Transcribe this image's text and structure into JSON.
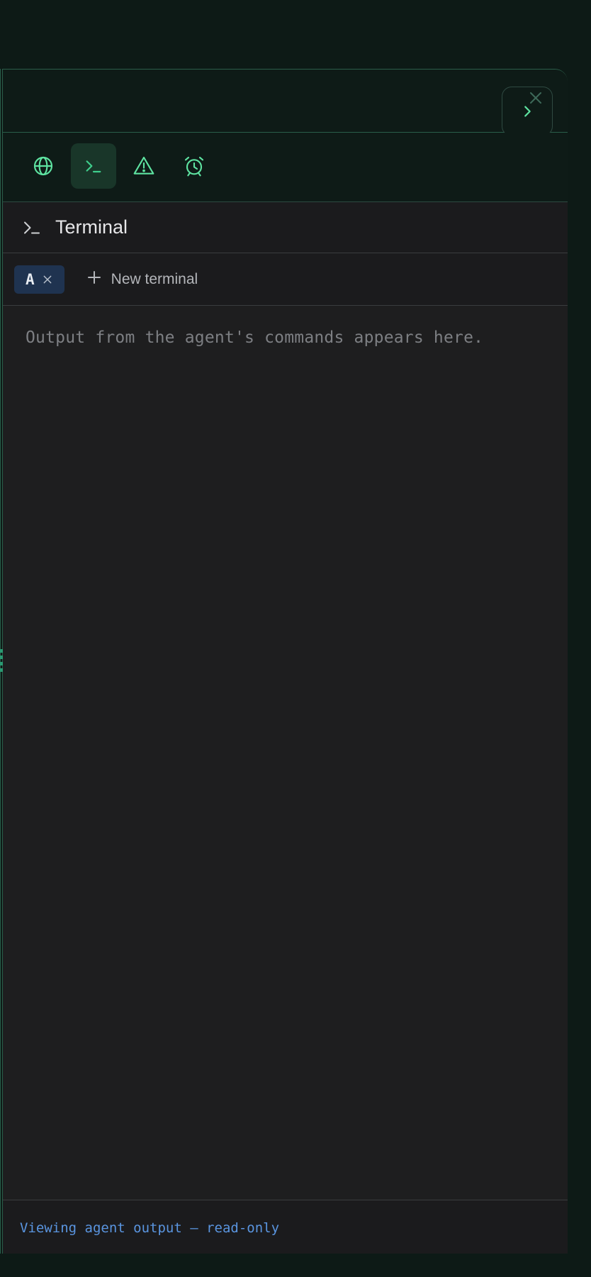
{
  "toolbar": {
    "tools": [
      {
        "name": "browser",
        "icon": "globe-icon",
        "active": false
      },
      {
        "name": "terminal",
        "icon": "terminal-icon",
        "active": true
      },
      {
        "name": "problems",
        "icon": "warning-triangle-icon",
        "active": false
      },
      {
        "name": "scheduled",
        "icon": "alarm-clock-icon",
        "active": false
      }
    ]
  },
  "terminal_panel": {
    "title": "Terminal",
    "tabs": [
      {
        "label": "A",
        "active": true
      }
    ],
    "new_terminal_label": "New terminal",
    "output_placeholder": "Output from the agent's commands appears here.",
    "status": "Viewing agent output — read-only"
  },
  "colors": {
    "accent": "#5ee3a1",
    "page_bg": "#0d1a16",
    "panel_bg": "#1e1e1f",
    "tab_active_bg": "#1f3350",
    "status_text": "#5a95e0"
  }
}
